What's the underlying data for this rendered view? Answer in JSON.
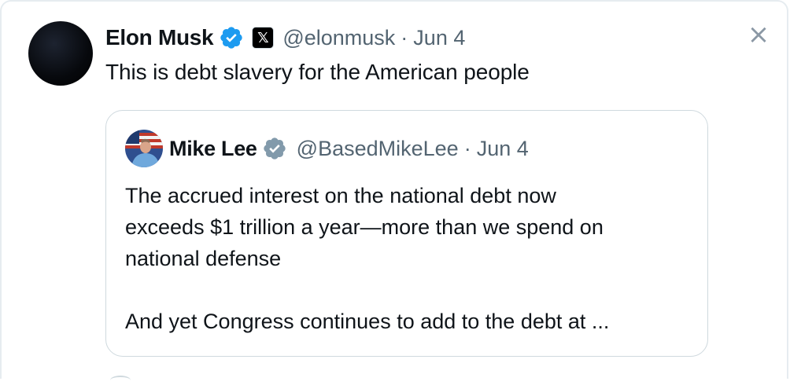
{
  "tweet": {
    "author_name": "Elon Musk",
    "handle": "@elonmusk",
    "separator": "·",
    "date": "Jun 4",
    "text": "This is debt slavery for the American people",
    "verified_badge_icon": "verified-blue-icon",
    "x_badge_icon": "x-logo-icon",
    "x_badge_glyph": "𝕏",
    "close_glyph": "×"
  },
  "quote": {
    "author_name": "Mike Lee",
    "handle": "@BasedMikeLee",
    "separator": "·",
    "date": "Jun 4",
    "verified_badge_icon": "verified-gray-icon",
    "lines": [
      "The accrued interest on the national debt now",
      "exceeds $1 trillion a year—more than we spend on",
      "national defense"
    ],
    "line_after_break": "And yet Congress continues to add to the debt at ..."
  },
  "colors": {
    "verified_blue": "#1d9bf0",
    "verified_gray": "#829aab",
    "secondary_text": "#536471",
    "border": "#cfd9de"
  }
}
